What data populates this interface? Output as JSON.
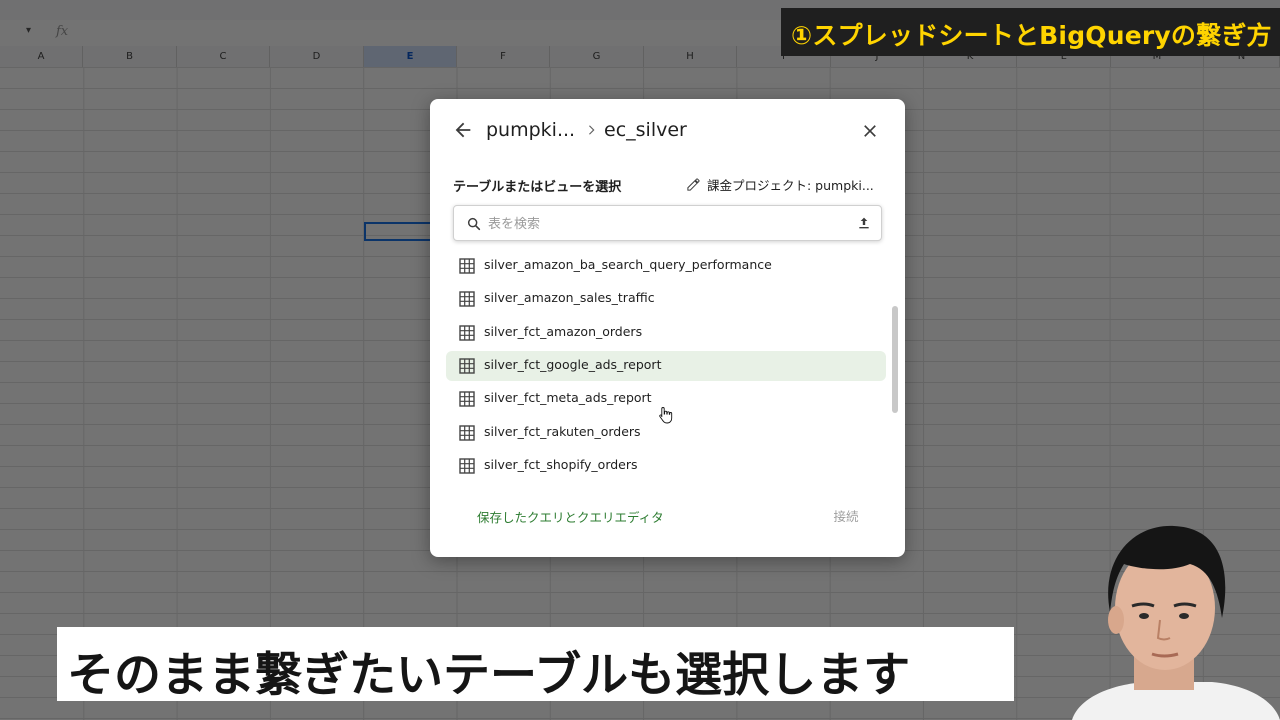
{
  "sheet": {
    "formula_prefix": "fx",
    "columns": [
      "A",
      "B",
      "C",
      "D",
      "E",
      "F",
      "G",
      "H",
      "I",
      "J",
      "K",
      "L",
      "M",
      "N"
    ],
    "selected_column": "E"
  },
  "banner": {
    "text": "①スプレッドシートとBigQueryの繋ぎ方",
    "color": "#ffd400"
  },
  "dialog": {
    "breadcrumb": {
      "project": "pumpki...",
      "dataset": "ec_silver"
    },
    "section_label": "テーブルまたはビューを選択",
    "billing_label": "課金プロジェクト: pumpki...",
    "search": {
      "placeholder": "表を検索",
      "value": ""
    },
    "tables": [
      {
        "name": "silver_amazon_ba_search_query_performance"
      },
      {
        "name": "silver_amazon_sales_traffic"
      },
      {
        "name": "silver_fct_amazon_orders"
      },
      {
        "name": "silver_fct_google_ads_report",
        "highlighted": true
      },
      {
        "name": "silver_fct_meta_ads_report"
      },
      {
        "name": "silver_fct_rakuten_orders"
      },
      {
        "name": "silver_fct_shopify_orders"
      }
    ],
    "footer_link": "保存したクエリとクエリエディタ",
    "connect_label": "接続",
    "accent_color": "#2e7d32"
  },
  "caption": {
    "text": "そのまま繋ぎたいテーブルも選択します"
  },
  "icons": [
    "back-arrow-icon",
    "chevron-right-icon",
    "close-icon",
    "pencil-icon",
    "search-icon",
    "upload-icon",
    "table-grid-icon",
    "hand-cursor-icon"
  ]
}
